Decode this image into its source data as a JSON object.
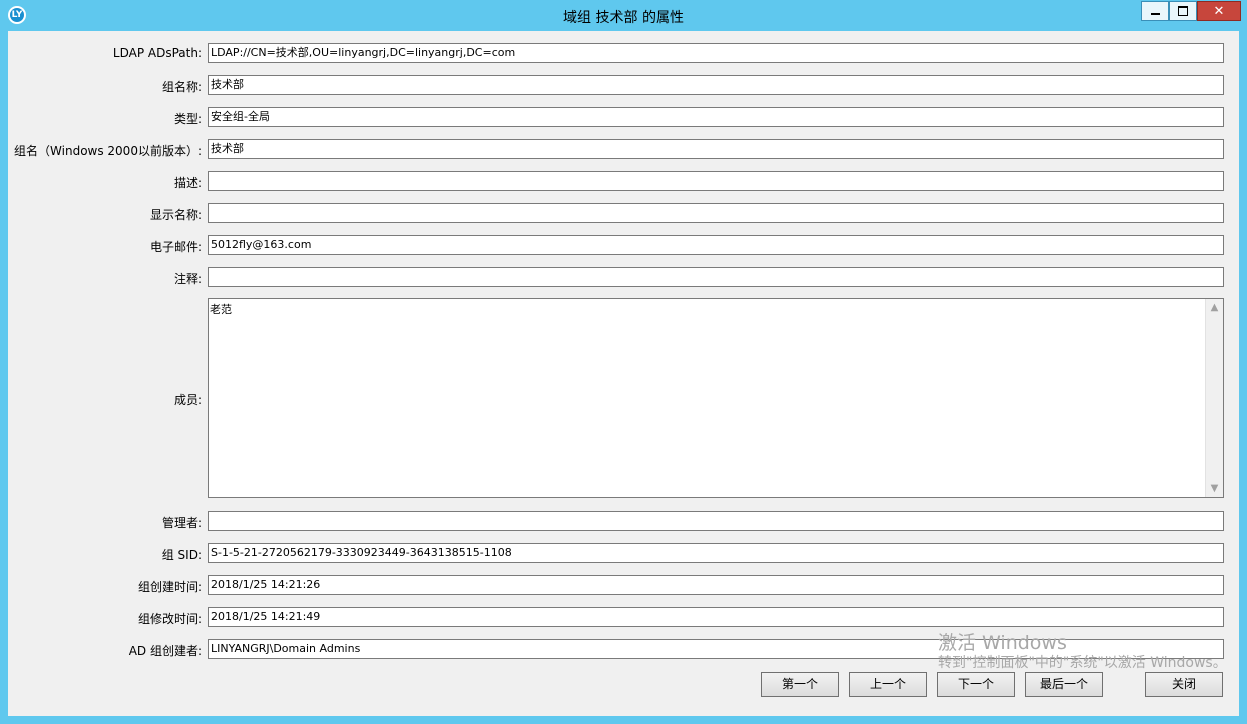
{
  "window": {
    "title": "域组 技术部 的属性",
    "app_icon_text": "LY",
    "close_symbol": "✕"
  },
  "fields": [
    {
      "label": "LDAP ADsPath:",
      "value": "LDAP://CN=技术部,OU=linyangrj,DC=linyangrj,DC=com"
    },
    {
      "label": "组名称:",
      "value": "技术部"
    },
    {
      "label": "类型:",
      "value": "安全组-全局"
    },
    {
      "label": "组名（Windows 2000以前版本）:",
      "value": "技术部"
    },
    {
      "label": "描述:",
      "value": ""
    },
    {
      "label": "显示名称:",
      "value": ""
    },
    {
      "label": "电子邮件:",
      "value": "5012fly@163.com"
    },
    {
      "label": "注释:",
      "value": ""
    }
  ],
  "members": {
    "label": "成员:",
    "value": "老范"
  },
  "fields2": [
    {
      "label": "管理者:",
      "value": ""
    },
    {
      "label": "组 SID:",
      "value": "S-1-5-21-2720562179-3330923449-3643138515-1108"
    },
    {
      "label": "组创建时间:",
      "value": "2018/1/25 14:21:26"
    },
    {
      "label": "组修改时间:",
      "value": "2018/1/25 14:21:49"
    },
    {
      "label": "AD 组创建者:",
      "value": "LINYANGRJ\\Domain Admins"
    }
  ],
  "buttons": {
    "first": "第一个",
    "prev": "上一个",
    "next": "下一个",
    "last": "最后一个",
    "close": "关闭"
  },
  "watermark": {
    "line1": "激活 Windows",
    "line2": "转到\"控制面板\"中的\"系统\"以激活 Windows。"
  }
}
